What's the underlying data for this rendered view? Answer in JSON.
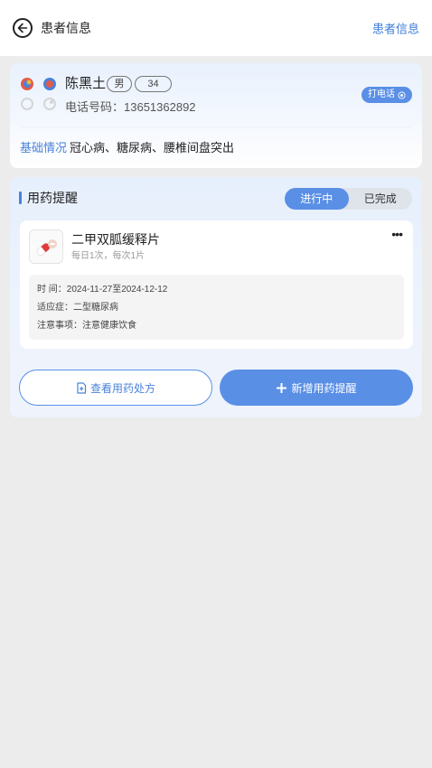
{
  "header": {
    "title": "患者信息",
    "right_link": "患者信息"
  },
  "patient": {
    "name": "陈黑土",
    "gender": "男",
    "age": "34",
    "phone_label": "电话号码：13651362892",
    "call_button": "打电话",
    "basic_label": "基础情况",
    "basic_value": "冠心病、糖尿病、腰椎间盘突出",
    "avatar_colors": [
      "#e25b4a",
      "#4a82da",
      "#f2b43a",
      "#d5d5d5"
    ]
  },
  "reminder": {
    "section_title": "用药提醒",
    "tabs": [
      {
        "label": "进行中",
        "active": true
      },
      {
        "label": "已完成",
        "active": false
      }
    ],
    "medication": {
      "name": "二甲双胍缓释片",
      "dose": "每日1次，每次1片",
      "time": "时    间：2024-11-27至2024-12-12",
      "indication": "适应症：二型糖尿病",
      "notes": "注意事项：注意健康饮食"
    },
    "view_prescription_button": "查看用药处方",
    "add_reminder_button": "新增用药提醒"
  },
  "colors": {
    "accent": "#5a8fe6",
    "link": "#3e7cd8",
    "background": "#ececec"
  }
}
